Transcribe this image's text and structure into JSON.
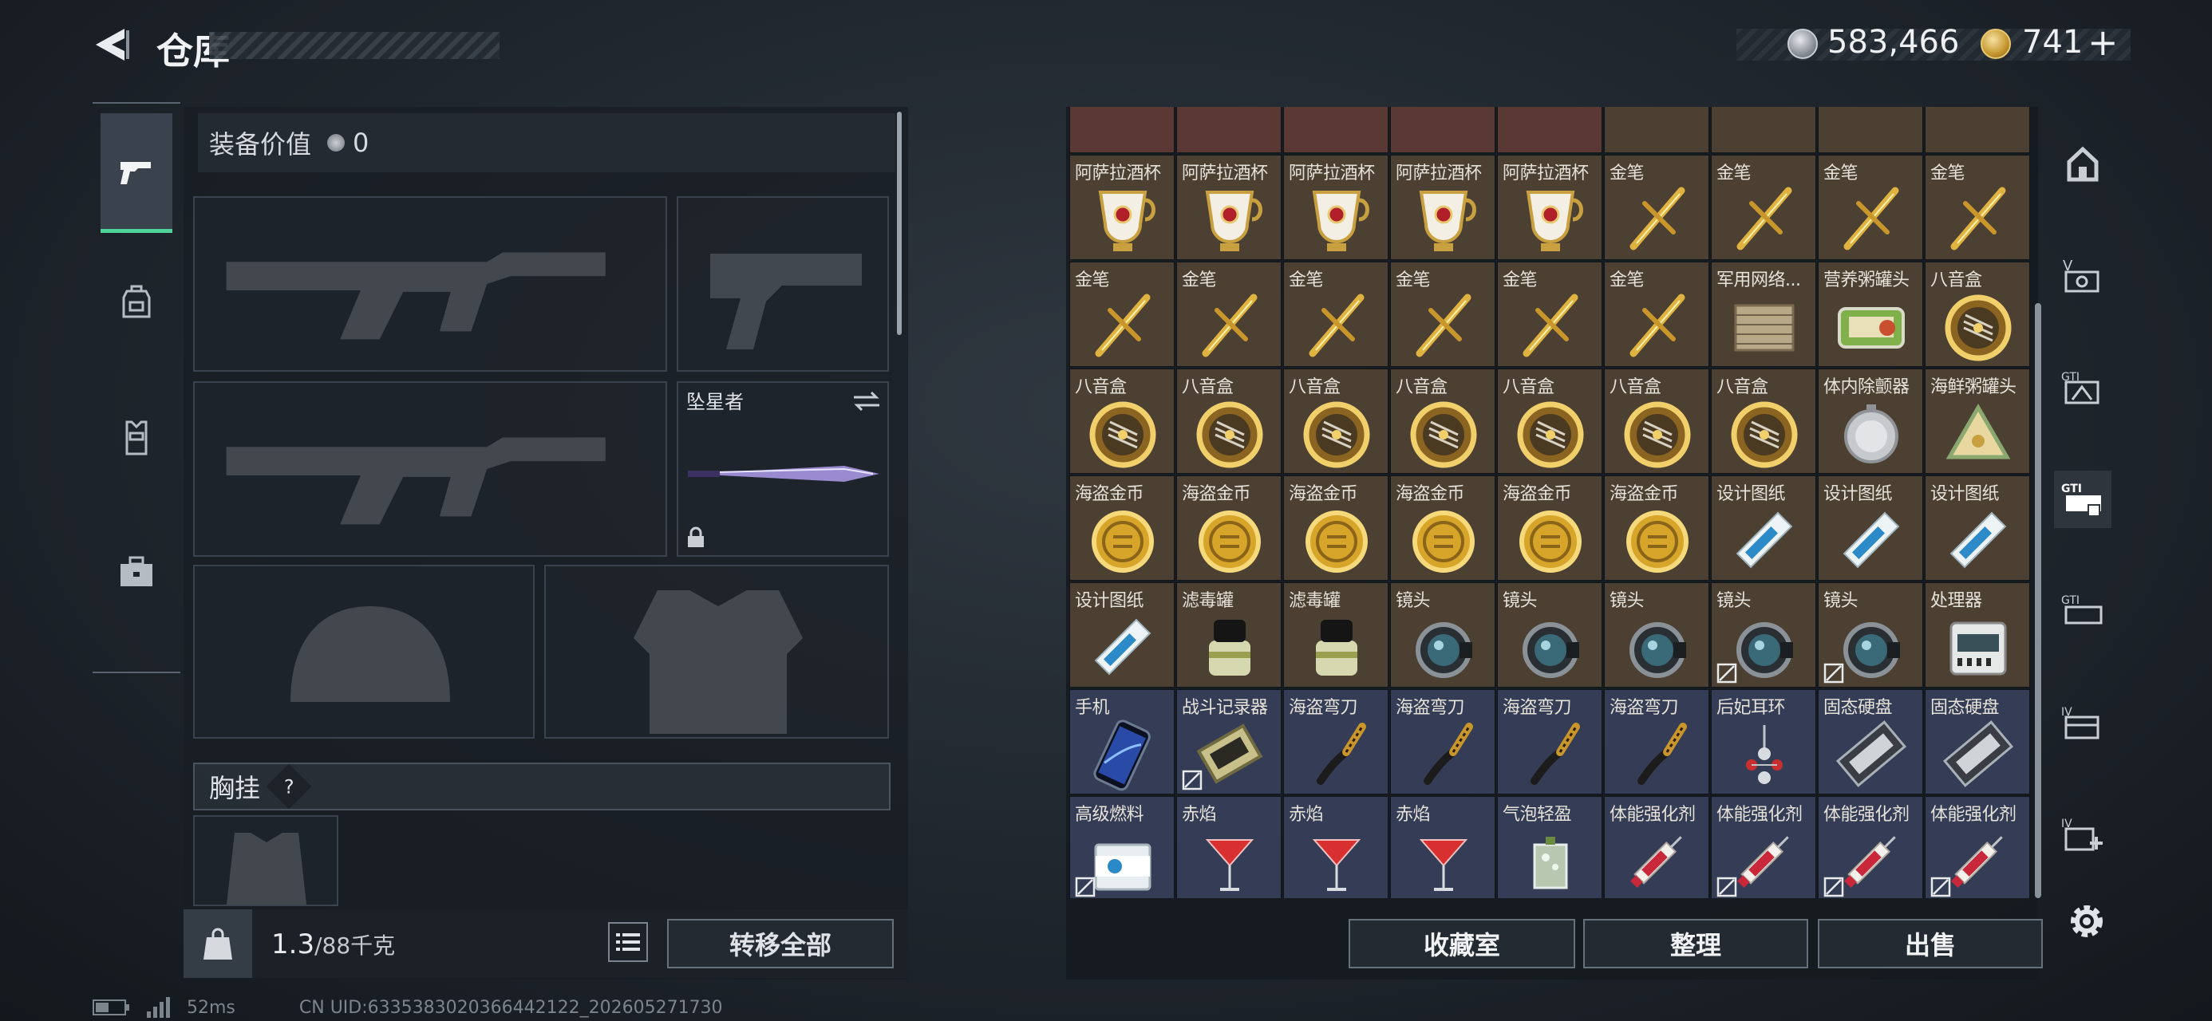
{
  "header": {
    "title": "仓库",
    "back_icon": "back-arrow-icon"
  },
  "currency": {
    "silver": "583,466",
    "gold": "741",
    "gold_plus": "+"
  },
  "left_tabs": [
    {
      "name": "weapon",
      "icon": "pistol-icon",
      "active": true
    },
    {
      "name": "backpack",
      "icon": "backpack-icon",
      "active": false
    },
    {
      "name": "vest",
      "icon": "vest-icon",
      "active": false
    },
    {
      "name": "case",
      "icon": "briefcase-icon",
      "active": false
    }
  ],
  "loadout": {
    "equip_value_label": "装备价值",
    "equip_value": "0",
    "melee_name": "坠星者",
    "chest_rig_label": "胸挂",
    "chest_rig_help": "?",
    "weight_current": "1.3",
    "weight_max": "/88千克",
    "transfer_all": "转移全部"
  },
  "warehouse": {
    "items": [
      {
        "label": "阿萨拉酒杯",
        "icon": "goblet"
      },
      {
        "label": "阿萨拉酒杯",
        "icon": "goblet"
      },
      {
        "label": "阿萨拉酒杯",
        "icon": "goblet"
      },
      {
        "label": "阿萨拉酒杯",
        "icon": "goblet"
      },
      {
        "label": "阿萨拉酒杯",
        "icon": "goblet"
      },
      {
        "label": "金笔",
        "icon": "pen"
      },
      {
        "label": "金笔",
        "icon": "pen"
      },
      {
        "label": "金笔",
        "icon": "pen"
      },
      {
        "label": "金笔",
        "icon": "pen"
      },
      {
        "label": "金笔",
        "icon": "pen"
      },
      {
        "label": "金笔",
        "icon": "pen"
      },
      {
        "label": "金笔",
        "icon": "pen"
      },
      {
        "label": "金笔",
        "icon": "pen"
      },
      {
        "label": "金笔",
        "icon": "pen"
      },
      {
        "label": "金笔",
        "icon": "pen"
      },
      {
        "label": "军用网络...",
        "icon": "board"
      },
      {
        "label": "营养粥罐头",
        "icon": "can"
      },
      {
        "label": "八音盒",
        "icon": "musicbox"
      },
      {
        "label": "八音盒",
        "icon": "musicbox"
      },
      {
        "label": "八音盒",
        "icon": "musicbox"
      },
      {
        "label": "八音盒",
        "icon": "musicbox"
      },
      {
        "label": "八音盒",
        "icon": "musicbox"
      },
      {
        "label": "八音盒",
        "icon": "musicbox"
      },
      {
        "label": "八音盒",
        "icon": "musicbox"
      },
      {
        "label": "八音盒",
        "icon": "musicbox"
      },
      {
        "label": "体内除颤器",
        "icon": "defib"
      },
      {
        "label": "海鲜粥罐头",
        "icon": "tricorn"
      },
      {
        "label": "海盗金币",
        "icon": "coin"
      },
      {
        "label": "海盗金币",
        "icon": "coin"
      },
      {
        "label": "海盗金币",
        "icon": "coin"
      },
      {
        "label": "海盗金币",
        "icon": "coin"
      },
      {
        "label": "海盗金币",
        "icon": "coin"
      },
      {
        "label": "海盗金币",
        "icon": "coin"
      },
      {
        "label": "设计图纸",
        "icon": "blueprint"
      },
      {
        "label": "设计图纸",
        "icon": "blueprint"
      },
      {
        "label": "设计图纸",
        "icon": "blueprint"
      },
      {
        "label": "设计图纸",
        "icon": "blueprint"
      },
      {
        "label": "滤毒罐",
        "icon": "filter"
      },
      {
        "label": "滤毒罐",
        "icon": "filter"
      },
      {
        "label": "镜头",
        "icon": "lens"
      },
      {
        "label": "镜头",
        "icon": "lens"
      },
      {
        "label": "镜头",
        "icon": "lens"
      },
      {
        "label": "镜头",
        "icon": "lens",
        "mark": true
      },
      {
        "label": "镜头",
        "icon": "lens",
        "mark": true
      },
      {
        "label": "处理器",
        "icon": "processor"
      },
      {
        "label": "手机",
        "icon": "phone"
      },
      {
        "label": "战斗记录器",
        "icon": "recorder",
        "mark": true
      },
      {
        "label": "海盗弯刀",
        "icon": "knife"
      },
      {
        "label": "海盗弯刀",
        "icon": "knife"
      },
      {
        "label": "海盗弯刀",
        "icon": "knife"
      },
      {
        "label": "海盗弯刀",
        "icon": "knife"
      },
      {
        "label": "后妃耳环",
        "icon": "earring"
      },
      {
        "label": "固态硬盘",
        "icon": "ssd"
      },
      {
        "label": "固态硬盘",
        "icon": "ssd"
      },
      {
        "label": "高级燃料",
        "icon": "fuel",
        "mark": true
      },
      {
        "label": "赤焰",
        "icon": "cocktail"
      },
      {
        "label": "赤焰",
        "icon": "cocktail"
      },
      {
        "label": "赤焰",
        "icon": "cocktail"
      },
      {
        "label": "气泡轻盈",
        "icon": "glass"
      },
      {
        "label": "体能强化剂",
        "icon": "syringe"
      },
      {
        "label": "体能强化剂",
        "icon": "syringe",
        "mark": true
      },
      {
        "label": "体能强化剂",
        "icon": "syringe",
        "mark": true
      },
      {
        "label": "体能强化剂",
        "icon": "syringe",
        "mark": true
      }
    ],
    "buttons": {
      "collection": "收藏室",
      "sort": "整理",
      "sell": "出售"
    }
  },
  "right_tabs": [
    {
      "name": "home",
      "icon": "house-icon",
      "active": false
    },
    {
      "name": "V",
      "icon": "vault-v-icon",
      "active": false
    },
    {
      "name": "GTI-1",
      "icon": "gti-stash-icon",
      "active": false
    },
    {
      "name": "GTI-2",
      "icon": "gti-active-stash-icon",
      "active": true
    },
    {
      "name": "GTI-3",
      "icon": "gti-stash-2-icon",
      "active": false
    },
    {
      "name": "IV",
      "icon": "stash-iv-icon",
      "active": false
    },
    {
      "name": "IV+",
      "icon": "stash-add-icon",
      "active": false
    }
  ],
  "status": {
    "latency": "52ms",
    "uid": "CN UID:6335383020366442122_202605271730"
  }
}
